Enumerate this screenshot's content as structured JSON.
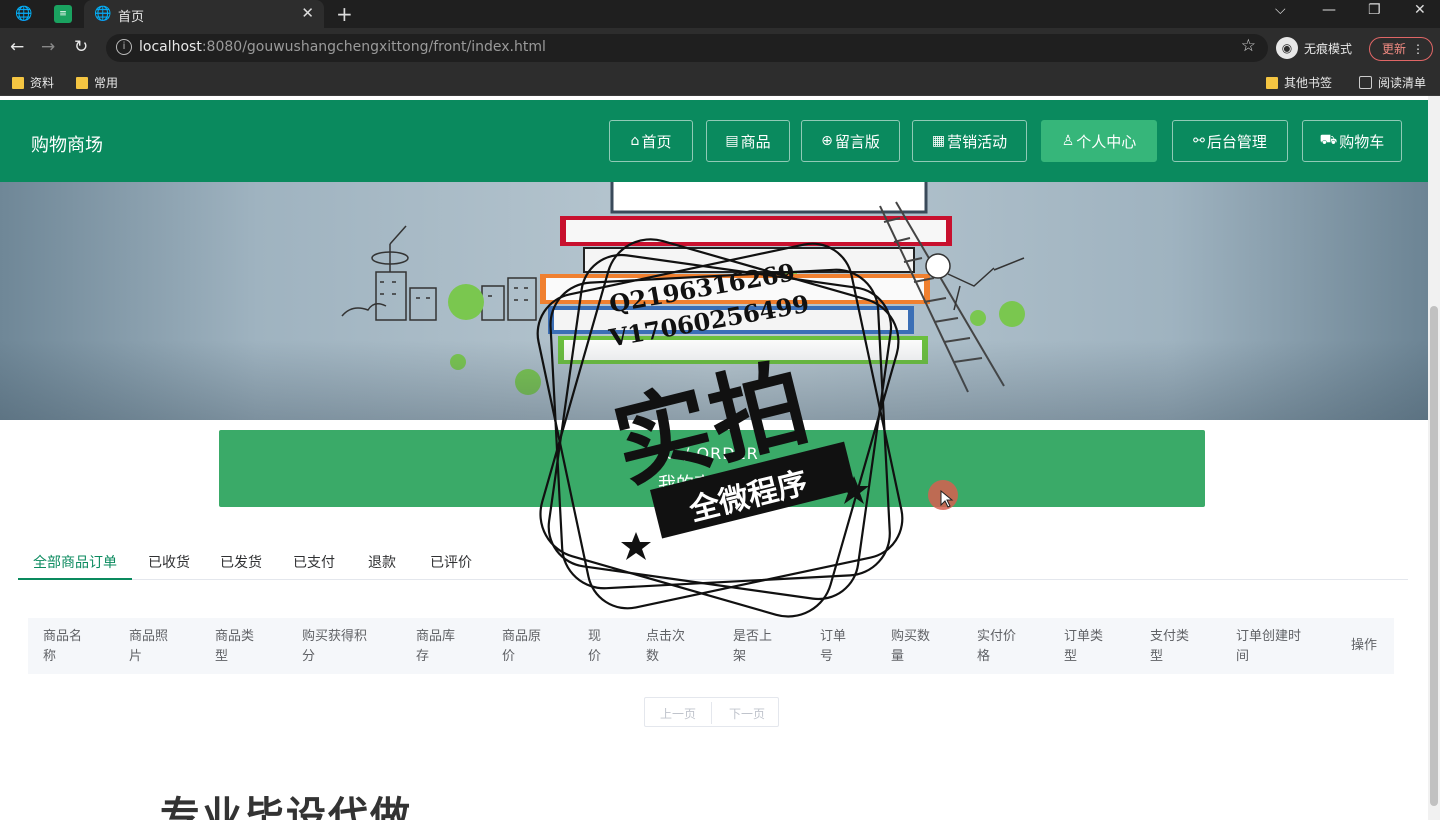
{
  "browser": {
    "tab_title": "首页",
    "url_host": "localhost",
    "url_rest": ":8080/gouwushangchengxittong/front/index.html",
    "incognito_label": "无痕模式",
    "update_label": "更新",
    "bookmarks": [
      "资料",
      "常用"
    ],
    "bookmarks_right": [
      "其他书签",
      "阅读清单"
    ]
  },
  "site": {
    "brand": "购物商场",
    "nav": [
      {
        "label": "首页",
        "icon": "home-icon"
      },
      {
        "label": "商品",
        "icon": "calendar-icon"
      },
      {
        "label": "留言版",
        "icon": "globe-icon"
      },
      {
        "label": "营销活动",
        "icon": "grid-icon"
      },
      {
        "label": "个人中心",
        "icon": "user-icon"
      },
      {
        "label": "后台管理",
        "icon": "link-icon"
      },
      {
        "label": "购物车",
        "icon": "cart-icon"
      }
    ],
    "active_nav": "个人中心"
  },
  "order_header": {
    "en": "U / ORDER",
    "zh": "我的商品订单"
  },
  "order_tabs": [
    "全部商品订单",
    "已收货",
    "已发货",
    "已支付",
    "退款",
    "已评价"
  ],
  "table_headers": [
    [
      "商品名",
      "称"
    ],
    [
      "商品照",
      "片"
    ],
    [
      "商品类",
      "型"
    ],
    [
      "购买获得积",
      "分"
    ],
    [
      "商品库",
      "存"
    ],
    [
      "商品原",
      "价"
    ],
    [
      "现",
      "价"
    ],
    [
      "点击次",
      "数"
    ],
    [
      "是否上",
      "架"
    ],
    [
      "订单",
      "号"
    ],
    [
      "购买数",
      "量"
    ],
    [
      "实付价",
      "格"
    ],
    [
      "订单类",
      "型"
    ],
    [
      "支付类",
      "型"
    ],
    [
      "订单创建时",
      "间"
    ],
    [
      "操作",
      ""
    ]
  ],
  "pager": {
    "prev": "上一页",
    "next": "下一页"
  },
  "footer_big_text": "专业毕设代做",
  "watermark": {
    "qq": "Q2196316269",
    "vx": "V17060256499",
    "big": "实拍",
    "ribbon": "全微程序"
  }
}
